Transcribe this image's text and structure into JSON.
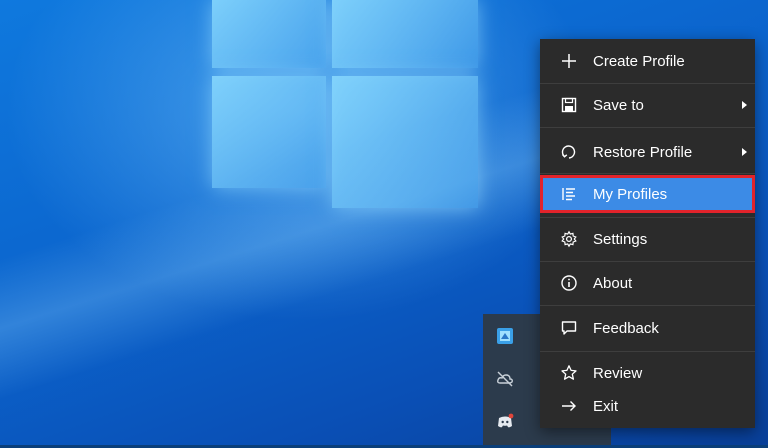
{
  "menu": {
    "items": [
      {
        "label": "Create Profile",
        "icon": "plus-icon"
      },
      {
        "label": "Save to",
        "icon": "save-icon",
        "submenu": true
      },
      {
        "label": "Restore Profile",
        "icon": "restore-icon",
        "submenu": true
      },
      {
        "label": "My Profiles",
        "icon": "list-icon",
        "highlighted": true
      },
      {
        "label": "Settings",
        "icon": "gear-icon"
      },
      {
        "label": "About",
        "icon": "info-icon"
      },
      {
        "label": "Feedback",
        "icon": "feedback-icon"
      },
      {
        "label": "Review",
        "icon": "star-icon"
      },
      {
        "label": "Exit",
        "icon": "exit-arrow-icon"
      }
    ]
  },
  "tray": {
    "icons": [
      "app-tray-icon",
      "cloud-off-icon",
      "discord-icon"
    ]
  },
  "colors": {
    "menu_bg": "#2b2b2b",
    "highlight": "#3c8be6",
    "highlight_border": "#e3232b",
    "desktop": "#0a5fc4"
  }
}
